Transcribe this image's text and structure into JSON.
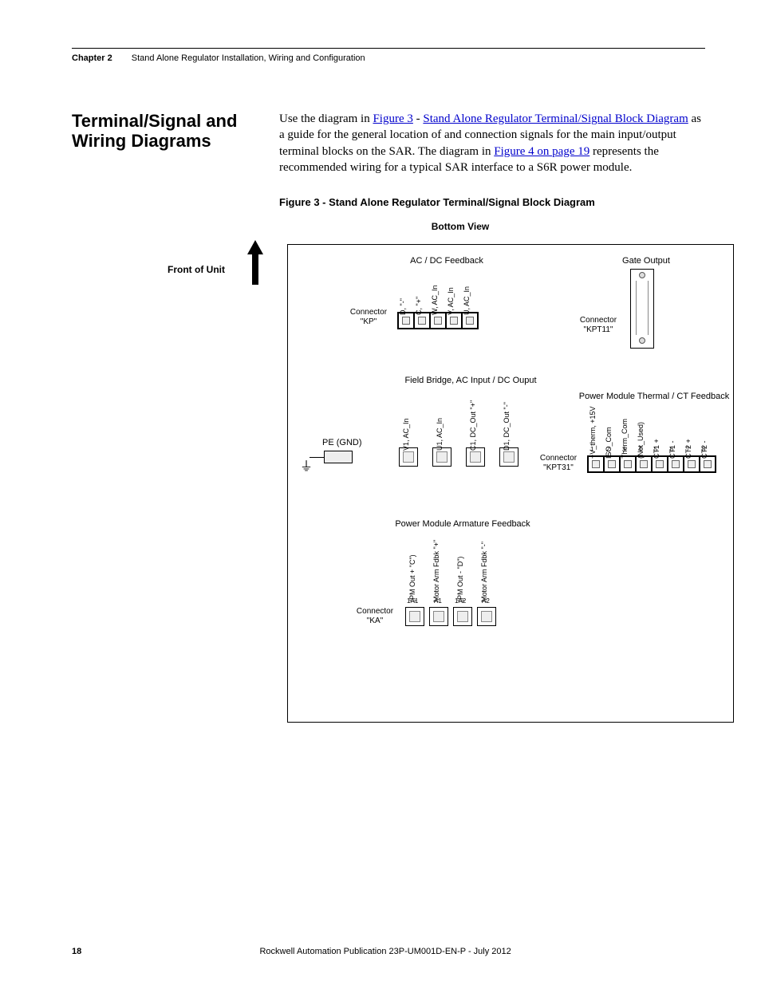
{
  "header": {
    "chapter": "Chapter 2",
    "title": "Stand Alone Regulator Installation, Wiring and Configuration"
  },
  "section": {
    "heading": "Terminal/Signal and Wiring Diagrams",
    "para_pre": "Use the diagram in ",
    "link1": "Figure 3",
    "dash": " - ",
    "link2": "Stand Alone Regulator Terminal/Signal Block Diagram",
    "para_mid": " as a guide for the general location of and connection signals for the main input/output terminal blocks on the SAR. The diagram in ",
    "link3": "Figure 4 on page 19",
    "para_end": " represents the recommended wiring for a typical SAR interface to a S6R power module."
  },
  "figure": {
    "caption": "Figure 3 - Stand Alone Regulator Terminal/Signal Block Diagram",
    "bottom_view": "Bottom View",
    "front_of_unit": "Front of Unit"
  },
  "groups": {
    "acdc": "AC / DC Feedback",
    "gate": "Gate Output",
    "field": "Field Bridge, AC Input / DC Ouput",
    "pmthermal": "Power Module Thermal / CT Feedback",
    "pe": "PE (GND)",
    "armature": "Power Module Armature Feedback"
  },
  "connectors": {
    "kp": "Connector \"KP\"",
    "kpt11": "Connector \"KPT11\"",
    "kpt31": "Connector \"KPT31\"",
    "ka": "Connector \"KA\""
  },
  "kp_terms": [
    "D, \"-\"",
    "C, \"+\"",
    "W, AC_In",
    "V, AC_In",
    "U, AC_In"
  ],
  "field_terms": [
    "V1, AC_In",
    "U1, AC_In",
    "C1, DC_Out \"+\"",
    "D1, DC_Out \"-\""
  ],
  "kpt31_terms": [
    "+V_therm, +15V",
    "ISO_Com",
    "Therm_Com",
    "(Not_Used)",
    "CT1 +",
    "CT1 -",
    "CT2 +",
    "CT2 -"
  ],
  "kpt31_nums": [
    "1",
    "2",
    "3",
    "4",
    "5",
    "6",
    "7",
    "8"
  ],
  "ka_terms": [
    "(PM Out + \"C\")",
    "Motor Arm Fdbk \"+\"",
    "(PM Out - \"D\")",
    "Motor Arm Fdbk \"-\""
  ],
  "ka_nums": [
    "1A1",
    "A1",
    "1A2",
    "A2"
  ],
  "footer": {
    "page": "18",
    "pub": "Rockwell Automation Publication 23P-UM001D-EN-P - July 2012"
  }
}
